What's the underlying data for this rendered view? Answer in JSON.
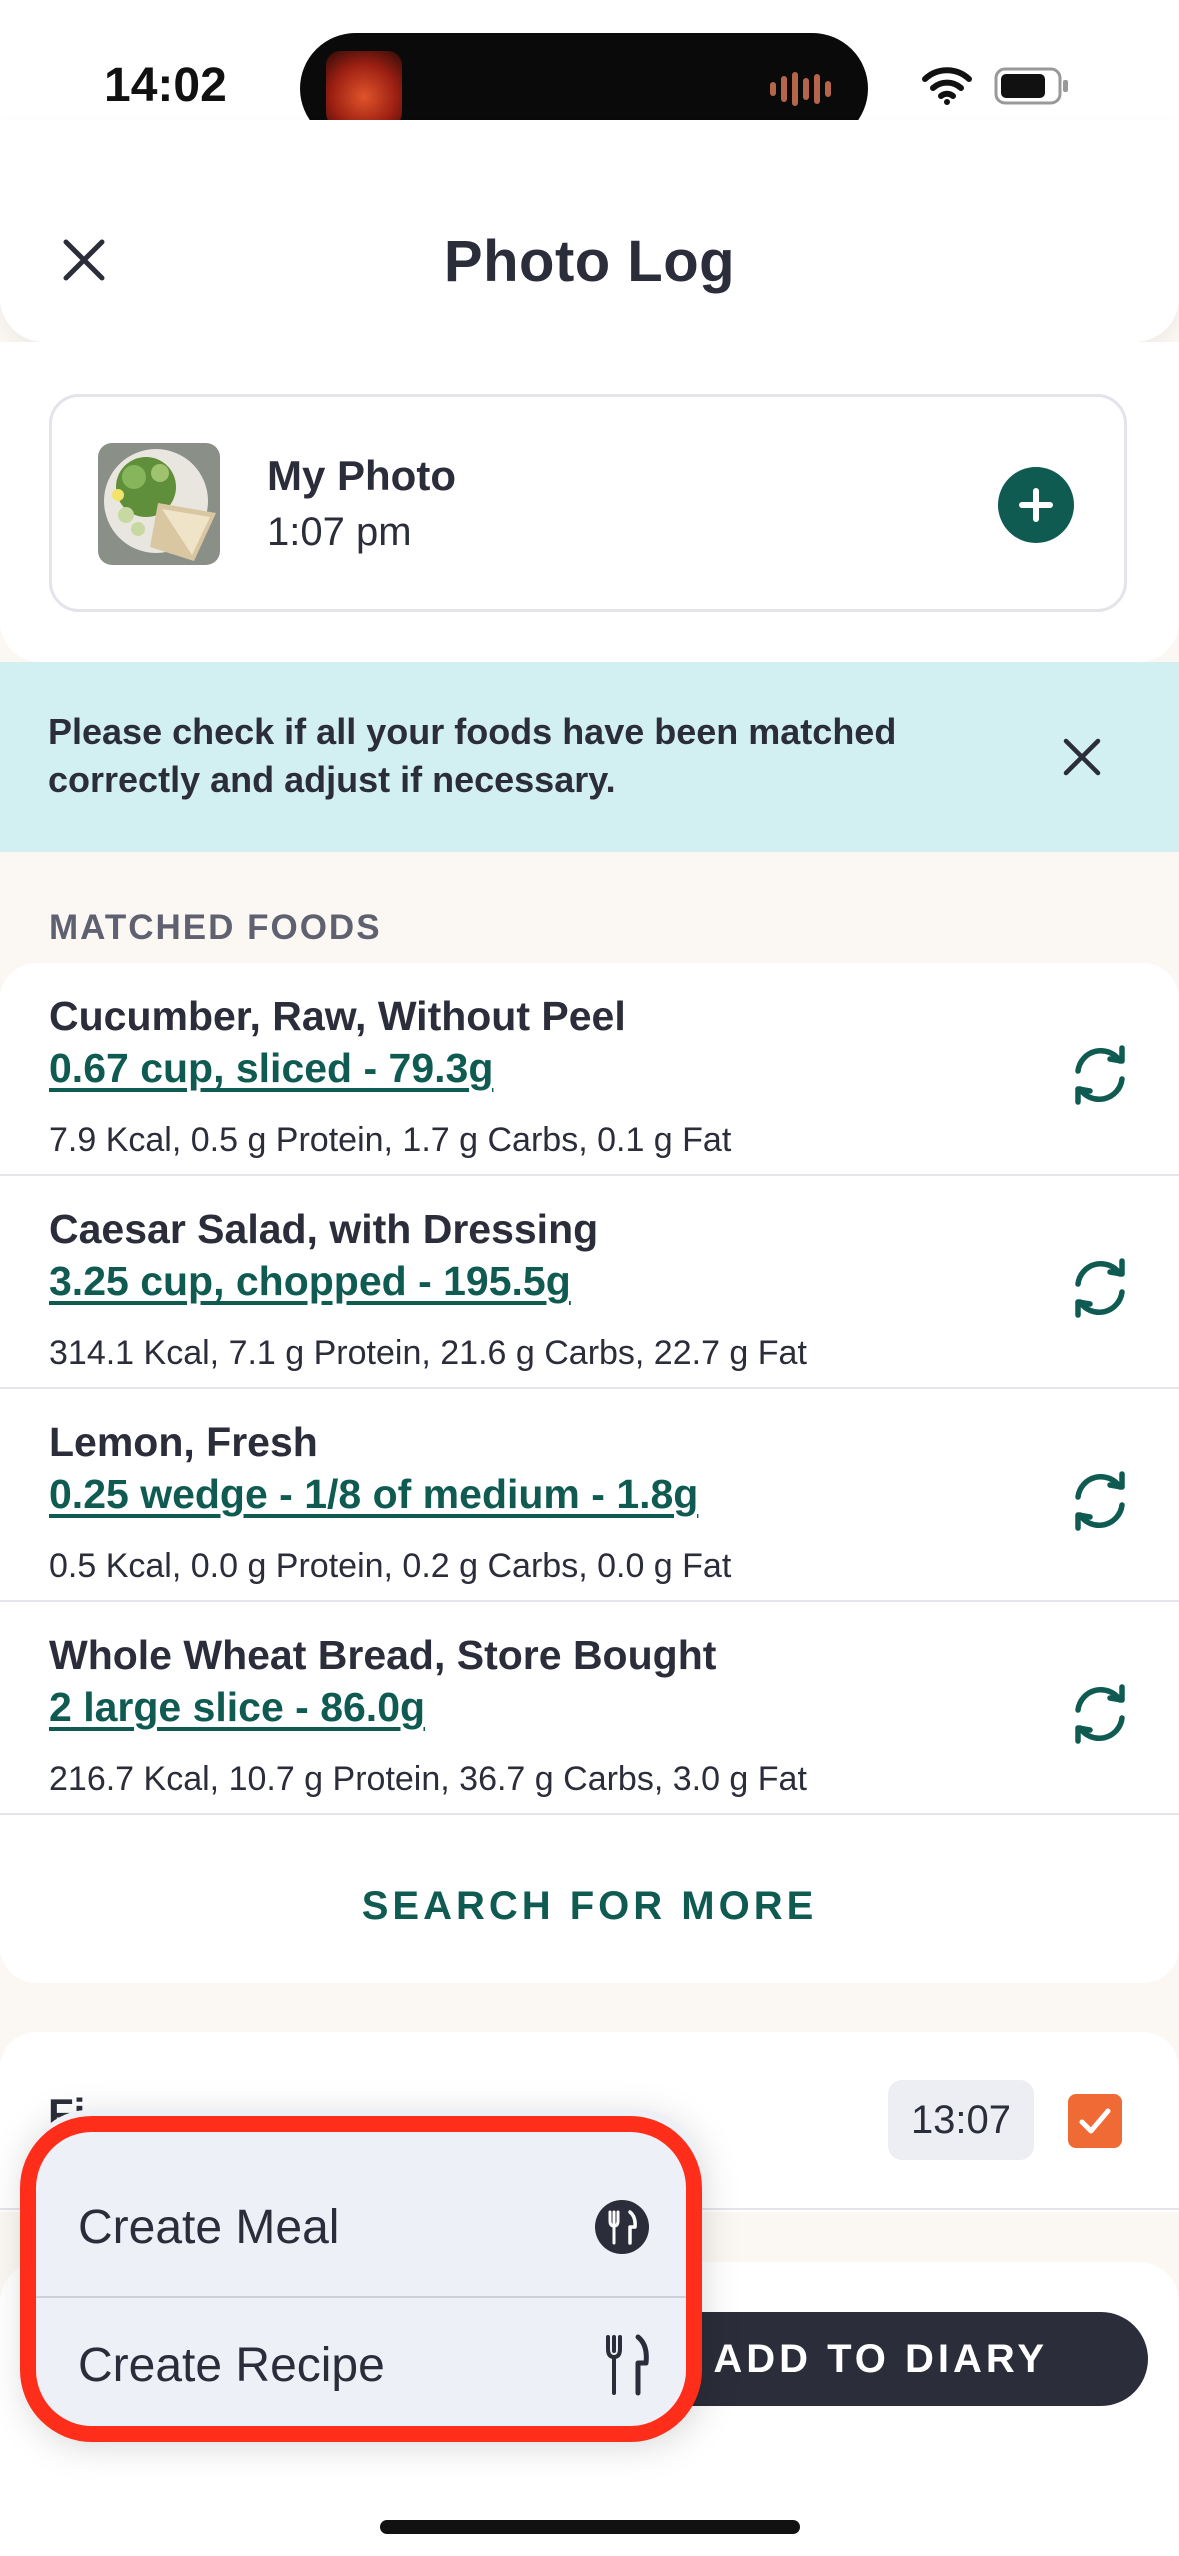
{
  "status_bar": {
    "time": "14:02"
  },
  "header": {
    "title": "Photo Log"
  },
  "photo": {
    "name": "My Photo",
    "time": "1:07 pm"
  },
  "banner": {
    "text": "Please check if all your foods have been matched correctly and adjust if necessary."
  },
  "matched": {
    "label": "MATCHED FOODS",
    "foods": [
      {
        "name": "Cucumber, Raw, Without Peel",
        "portion": "0.67 cup, sliced - 79.3g",
        "macros": "7.9 Kcal, 0.5 g Protein, 1.7 g Carbs, 0.1 g Fat"
      },
      {
        "name": "Caesar Salad, with Dressing",
        "portion": "3.25 cup, chopped - 195.5g",
        "macros": "314.1 Kcal, 7.1 g Protein, 21.6 g Carbs, 22.7 g Fat"
      },
      {
        "name": "Lemon, Fresh",
        "portion": "0.25 wedge - 1/8 of medium - 1.8g",
        "macros": "0.5 Kcal, 0.0 g Protein, 0.2 g Carbs, 0.0 g Fat"
      },
      {
        "name": "Whole Wheat Bread, Store Bought",
        "portion": "2 large slice - 86.0g",
        "macros": "216.7 Kcal, 10.7 g Protein, 36.7 g Carbs, 3.0 g Fat"
      }
    ],
    "search_more": "SEARCH FOR MORE"
  },
  "meal": {
    "label": "Fi...",
    "time": "13:07"
  },
  "footer": {
    "add_to_diary": "ADD TO DIARY"
  },
  "popup": {
    "items": [
      {
        "label": "Create Meal",
        "icon": "meal-icon"
      },
      {
        "label": "Create Recipe",
        "icon": "fork-knife-icon"
      }
    ]
  },
  "colors": {
    "accent": "#0f5b52",
    "banner": "#d2eff2",
    "checkbox": "#f06a36",
    "highlight": "#ff2e1a",
    "dark": "#2b2d3a"
  }
}
